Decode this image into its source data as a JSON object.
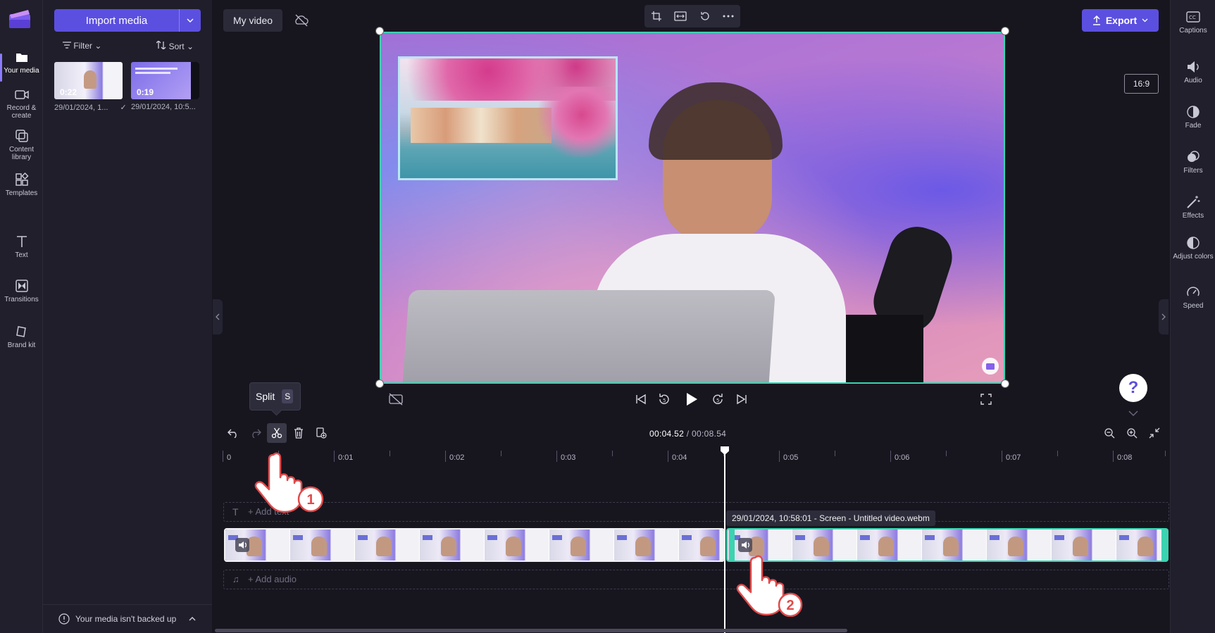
{
  "left_rail": {
    "items": [
      {
        "label": "Your media",
        "icon": "folder-icon"
      },
      {
        "label": "Record & create",
        "icon": "camera-icon"
      },
      {
        "label": "Content library",
        "icon": "library-icon"
      },
      {
        "label": "Templates",
        "icon": "templates-icon"
      },
      {
        "label": "Text",
        "icon": "text-icon"
      },
      {
        "label": "Transitions",
        "icon": "transitions-icon"
      },
      {
        "label": "Brand kit",
        "icon": "brand-icon"
      }
    ]
  },
  "media_panel": {
    "import_label": "Import media",
    "filter_label": "Filter",
    "sort_label": "Sort",
    "items": [
      {
        "duration": "0:22",
        "label": "29/01/2024, 1..."
      },
      {
        "duration": "0:19",
        "label": "29/01/2024, 10:5..."
      }
    ],
    "backup_text": "Your media isn't backed up"
  },
  "header": {
    "project_title": "My video",
    "export_label": "Export",
    "aspect_ratio": "16:9"
  },
  "timeline": {
    "current_time": "00:04.52",
    "total_time": "/ 00:08.54",
    "split_tooltip": "Split",
    "split_key": "S",
    "ruler": [
      "0",
      "0:01",
      "0:02",
      "0:03",
      "0:04",
      "0:05",
      "0:06",
      "0:07",
      "0:08"
    ],
    "add_text": "+ Add text",
    "add_audio": "+ Add audio",
    "clip_label": "29/01/2024, 10:58:01 - Screen - Untitled video.webm",
    "steps": [
      "1",
      "2"
    ]
  },
  "right_rail": {
    "items": [
      {
        "label": "Captions",
        "icon": "captions-icon"
      },
      {
        "label": "Audio",
        "icon": "speaker-icon"
      },
      {
        "label": "Fade",
        "icon": "fade-icon"
      },
      {
        "label": "Filters",
        "icon": "filters-icon"
      },
      {
        "label": "Effects",
        "icon": "wand-icon"
      },
      {
        "label": "Adjust colors",
        "icon": "contrast-icon"
      },
      {
        "label": "Speed",
        "icon": "speedometer-icon"
      }
    ]
  },
  "colors": {
    "accent": "#5b4fe0",
    "selection": "#39d3b2",
    "background": "#17161f"
  }
}
